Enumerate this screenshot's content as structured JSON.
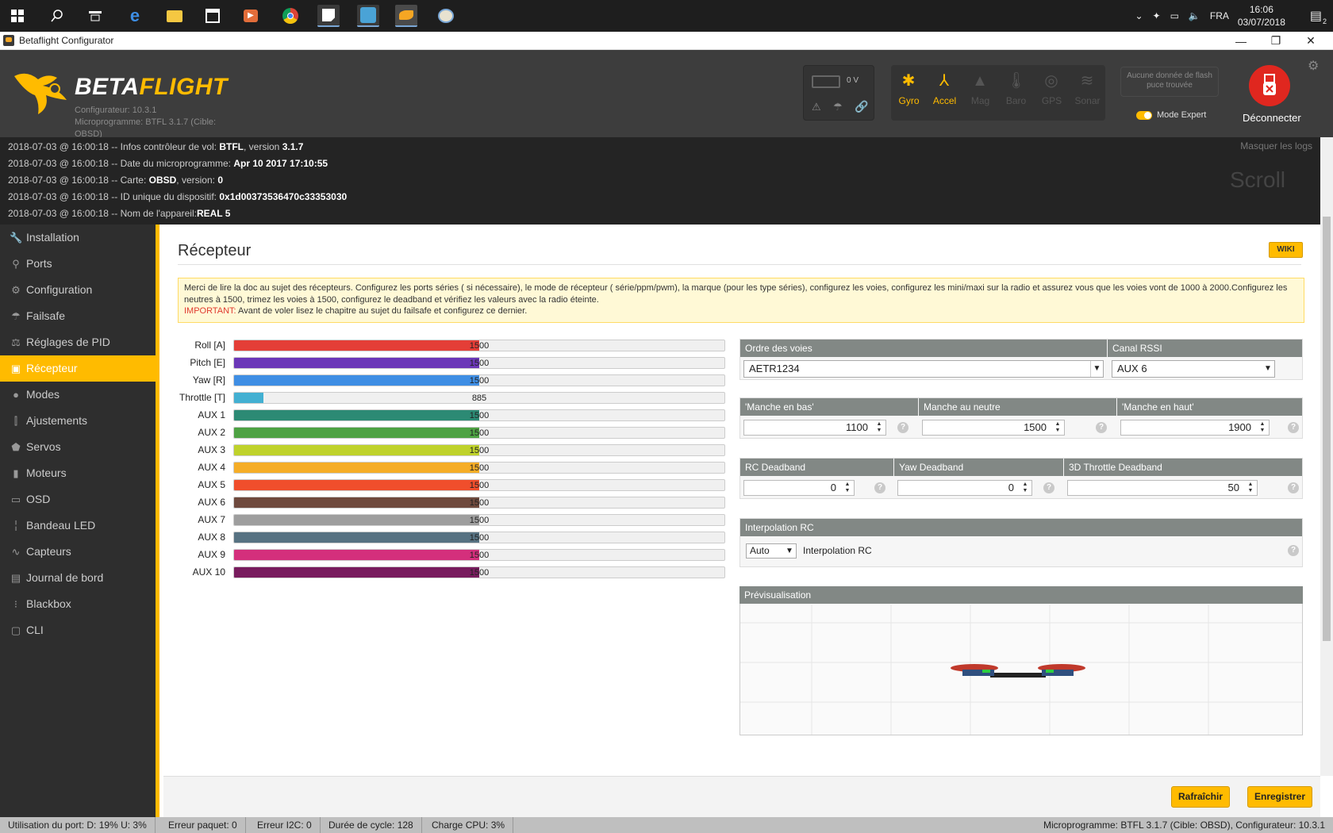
{
  "taskbar": {
    "lang": "FRA",
    "time": "16:06",
    "date": "03/07/2018",
    "notif_count": "2"
  },
  "window": {
    "title": "Betaflight Configurator"
  },
  "header": {
    "logo_beta": "BETA",
    "logo_flight": "FLIGHT",
    "configurator": "Configurateur: 10.3.1",
    "firmware_line1": "Microprogramme: BTFL 3.1.7 (Cible:",
    "firmware_line2": "OBSD)",
    "battery_voltage": "0 V",
    "sensors": [
      {
        "label": "Gyro",
        "icon": "gyro-icon",
        "active": true
      },
      {
        "label": "Accel",
        "icon": "accel-icon",
        "active": true
      },
      {
        "label": "Mag",
        "icon": "mag-icon",
        "active": false
      },
      {
        "label": "Baro",
        "icon": "baro-icon",
        "active": false
      },
      {
        "label": "GPS",
        "icon": "gps-icon",
        "active": false
      },
      {
        "label": "Sonar",
        "icon": "sonar-icon",
        "active": false
      }
    ],
    "flash_line1": "Aucune donnée de flash",
    "flash_line2": "puce trouvée",
    "expert_mode": "Mode Expert",
    "disconnect": "Déconnecter"
  },
  "log": {
    "hide": "Masquer les logs",
    "scroll": "Scroll",
    "lines": [
      {
        "prefix": "2018-07-03 @ 16:00:18 -- Infos contrôleur de vol: ",
        "bold": "BTFL",
        "suffix": ", version ",
        "bold2": "3.1.7"
      },
      {
        "prefix": "2018-07-03 @ 16:00:18 -- Date du microprogramme: ",
        "bold": "Apr 10 2017 17:10:55",
        "suffix": "",
        "bold2": ""
      },
      {
        "prefix": "2018-07-03 @ 16:00:18 -- Carte: ",
        "bold": "OBSD",
        "suffix": ", version: ",
        "bold2": "0"
      },
      {
        "prefix": "2018-07-03 @ 16:00:18 -- ID unique du dispositif: ",
        "bold": "0x1d00373536470c33353030",
        "suffix": "",
        "bold2": ""
      },
      {
        "prefix": "2018-07-03 @ 16:00:18 -- Nom de l'appareil:",
        "bold": "REAL 5",
        "suffix": "",
        "bold2": ""
      }
    ]
  },
  "sidebar": {
    "items": [
      {
        "label": "Installation",
        "icon": "wrench-icon"
      },
      {
        "label": "Ports",
        "icon": "plug-icon"
      },
      {
        "label": "Configuration",
        "icon": "gear-icon"
      },
      {
        "label": "Failsafe",
        "icon": "parachute-icon"
      },
      {
        "label": "Réglages de PID",
        "icon": "pid-icon"
      },
      {
        "label": "Récepteur",
        "icon": "receiver-icon",
        "active": true
      },
      {
        "label": "Modes",
        "icon": "modes-icon"
      },
      {
        "label": "Ajustements",
        "icon": "sliders-icon"
      },
      {
        "label": "Servos",
        "icon": "servo-icon"
      },
      {
        "label": "Moteurs",
        "icon": "motor-icon"
      },
      {
        "label": "OSD",
        "icon": "osd-icon"
      },
      {
        "label": "Bandeau LED",
        "icon": "led-icon"
      },
      {
        "label": "Capteurs",
        "icon": "sensor-icon"
      },
      {
        "label": "Journal de bord",
        "icon": "logbook-icon"
      },
      {
        "label": "Blackbox",
        "icon": "blackbox-icon"
      },
      {
        "label": "CLI",
        "icon": "cli-icon"
      }
    ]
  },
  "main": {
    "title": "Récepteur",
    "wiki": "WIKI",
    "note_text": "Merci de lire la doc au sujet des récepteurs. Configurez les ports séries ( si nécessaire), le mode de récepteur ( série/ppm/pwm), la marque (pour les type séries), configurez les voies, configurez les mini/maxi sur la radio et assurez vous que les voies vont de 1000 à 2000.Configurez les neutres à 1500, trimez les voies à 1500, configurez le deadband et vérifiez les valeurs avec la radio éteinte.",
    "note_important": "IMPORTANT:",
    "note_important_text": " Avant de voler lisez le chapitre au sujet du failsafe et configurez ce dernier.",
    "channels": [
      {
        "label": "Roll [A]",
        "value": "1500",
        "fraction": 0.5,
        "color": "#e43e37"
      },
      {
        "label": "Pitch [E]",
        "value": "1500",
        "fraction": 0.5,
        "color": "#6b37b8"
      },
      {
        "label": "Yaw [R]",
        "value": "1500",
        "fraction": 0.5,
        "color": "#3f8ee4"
      },
      {
        "label": "Throttle [T]",
        "value": "885",
        "fraction": 0.06,
        "color": "#43b0d2"
      },
      {
        "label": "AUX 1",
        "value": "1500",
        "fraction": 0.5,
        "color": "#2c8a74"
      },
      {
        "label": "AUX 2",
        "value": "1500",
        "fraction": 0.5,
        "color": "#4ea243"
      },
      {
        "label": "AUX 3",
        "value": "1500",
        "fraction": 0.5,
        "color": "#bfd22b"
      },
      {
        "label": "AUX 4",
        "value": "1500",
        "fraction": 0.5,
        "color": "#f5ad27"
      },
      {
        "label": "AUX 5",
        "value": "1500",
        "fraction": 0.5,
        "color": "#f04e2c"
      },
      {
        "label": "AUX 6",
        "value": "1500",
        "fraction": 0.5,
        "color": "#6f4a3e"
      },
      {
        "label": "AUX 7",
        "value": "1500",
        "fraction": 0.5,
        "color": "#9e9e9e"
      },
      {
        "label": "AUX 8",
        "value": "1500",
        "fraction": 0.5,
        "color": "#577282"
      },
      {
        "label": "AUX 9",
        "value": "1500",
        "fraction": 0.5,
        "color": "#d42f7c"
      },
      {
        "label": "AUX 10",
        "value": "1500",
        "fraction": 0.5,
        "color": "#781c5e"
      }
    ],
    "channel_map": {
      "label": "Ordre des voies",
      "value": "AETR1234"
    },
    "rssi": {
      "label": "Canal RSSI",
      "value": "AUX 6"
    },
    "stick_low": {
      "label": "'Manche en bas'",
      "value": "1100"
    },
    "stick_center": {
      "label": "Manche au neutre",
      "value": "1500"
    },
    "stick_high": {
      "label": "'Manche en haut'",
      "value": "1900"
    },
    "rc_deadband": {
      "label": "RC Deadband",
      "value": "0"
    },
    "yaw_deadband": {
      "label": "Yaw Deadband",
      "value": "0"
    },
    "throttle3d_deadband": {
      "label": "3D Throttle Deadband",
      "value": "50"
    },
    "interpolation": {
      "header": "Interpolation RC",
      "select": "Auto",
      "label": "Interpolation RC"
    },
    "preview": {
      "header": "Prévisualisation"
    }
  },
  "buttons": {
    "refresh": "Rafraîchir",
    "save": "Enregistrer"
  },
  "status": {
    "port": "Utilisation du port: D: 19% U: 3%",
    "packet": "Erreur paquet: 0",
    "i2c": "Erreur I2C: 0",
    "cycle": "Durée de cycle: 128",
    "cpu": "Charge CPU: 3%",
    "version": "Microprogramme: BTFL 3.1.7 (Cible: OBSD), Configurateur: 10.3.1"
  }
}
